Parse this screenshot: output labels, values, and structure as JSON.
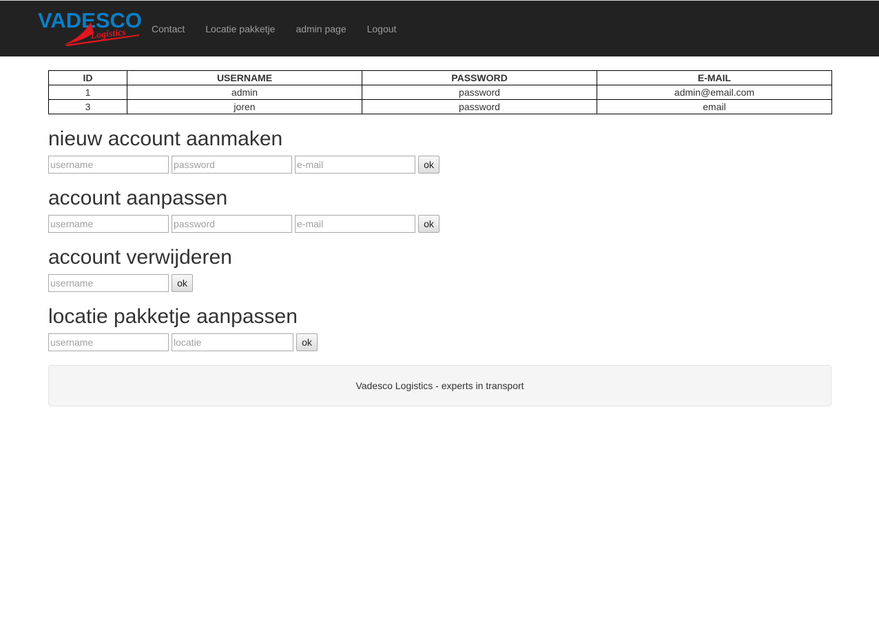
{
  "brand": {
    "name": "VADESCO",
    "tagline": "Logistics",
    "primary_color": "#0a7ec8",
    "accent_color": "#e0161e"
  },
  "nav": {
    "items": [
      {
        "label": "Contact"
      },
      {
        "label": "Locatie pakketje"
      },
      {
        "label": "admin page"
      },
      {
        "label": "Logout"
      }
    ]
  },
  "users_table": {
    "headers": [
      "ID",
      "USERNAME",
      "PASSWORD",
      "E-MAIL"
    ],
    "rows": [
      [
        "1",
        "admin",
        "password",
        "admin@email.com"
      ],
      [
        "3",
        "joren",
        "password",
        "email"
      ]
    ]
  },
  "sections": {
    "create": {
      "title": "nieuw account aanmaken",
      "username_placeholder": "username",
      "password_placeholder": "password",
      "email_placeholder": "e-mail",
      "button": "ok"
    },
    "edit": {
      "title": "account aanpassen",
      "username_placeholder": "username",
      "password_placeholder": "password",
      "email_placeholder": "e-mail",
      "button": "ok"
    },
    "delete": {
      "title": "account verwijderen",
      "username_placeholder": "username",
      "button": "ok"
    },
    "location": {
      "title": "locatie pakketje aanpassen",
      "username_placeholder": "username",
      "location_placeholder": "locatie",
      "button": "ok"
    }
  },
  "footer": {
    "text": "Vadesco Logistics - experts in transport"
  }
}
